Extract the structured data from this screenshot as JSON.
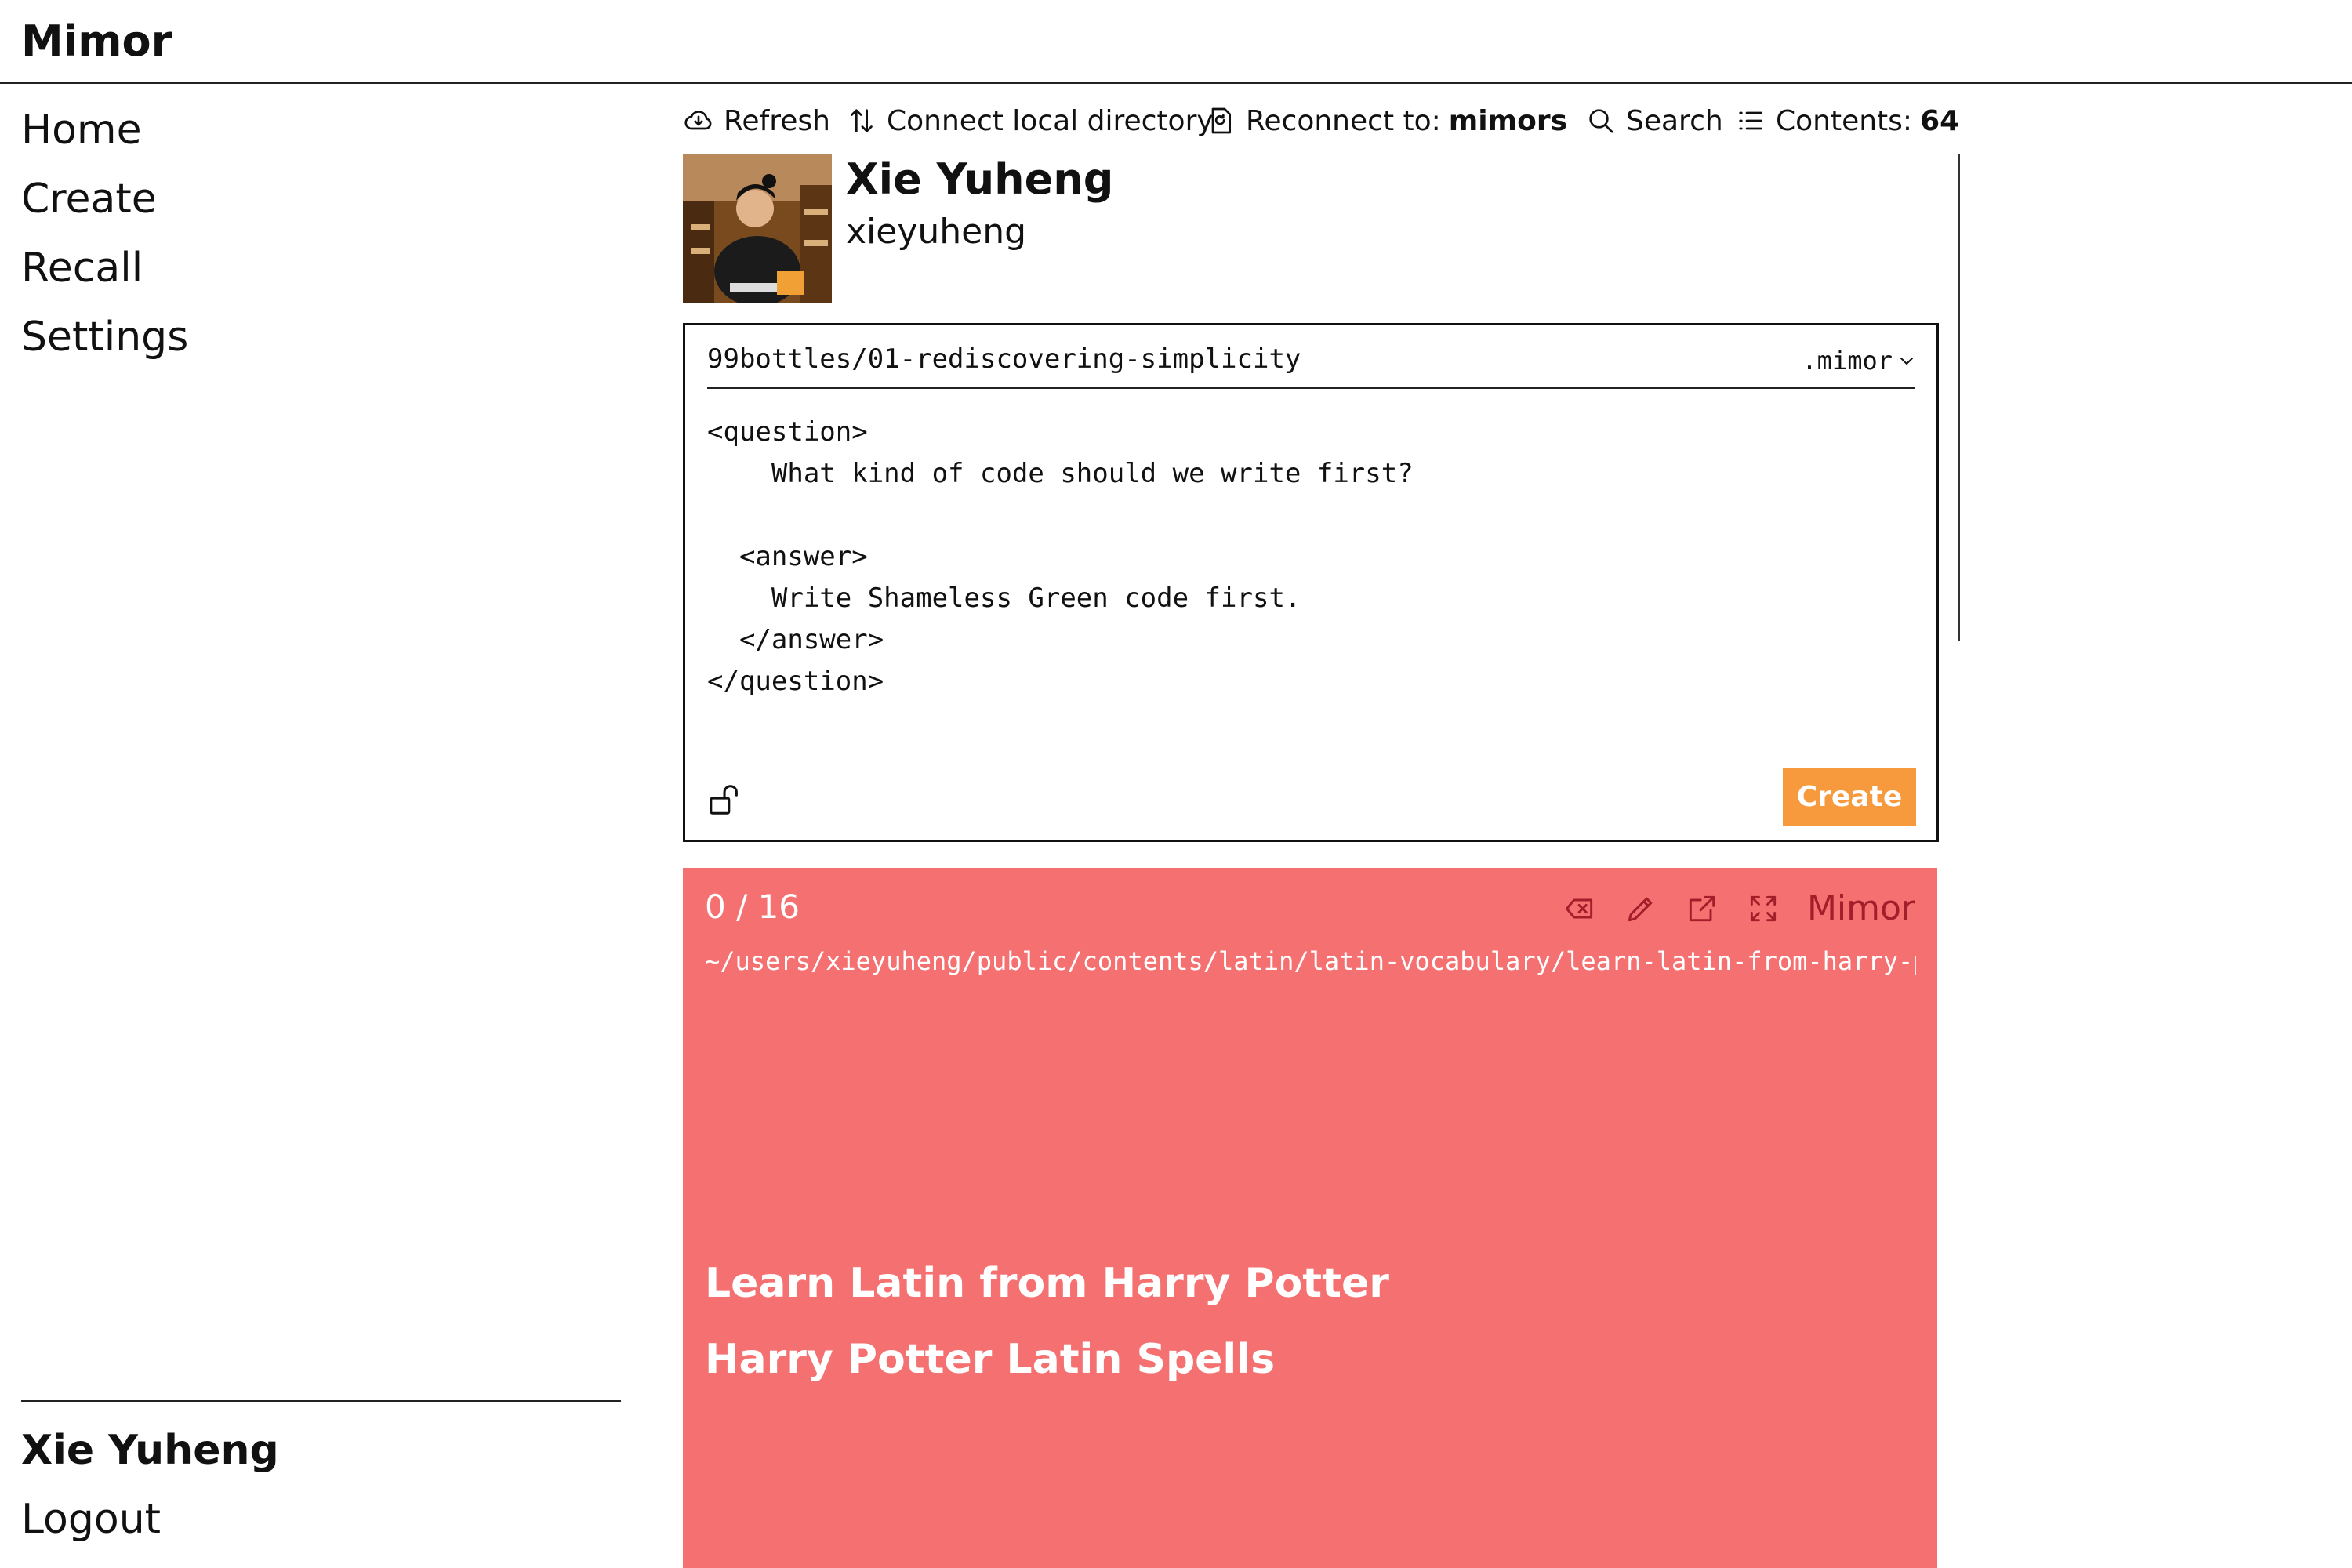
{
  "app": {
    "title": "Mimor"
  },
  "sidebar": {
    "items": [
      {
        "label": "Home"
      },
      {
        "label": "Create"
      },
      {
        "label": "Recall"
      },
      {
        "label": "Settings"
      }
    ],
    "user_name": "Xie Yuheng",
    "logout_label": "Logout"
  },
  "toolbar": {
    "refresh_label": "Refresh",
    "connect_label": "Connect local directory",
    "reconnect_label": "Reconnect to:",
    "reconnect_target": "mimors",
    "search_label": "Search",
    "contents_label": "Contents:",
    "contents_count": "64"
  },
  "profile": {
    "name": "Xie Yuheng",
    "handle": "xieyuheng"
  },
  "editor": {
    "path": "99bottles/01-rediscovering-simplicity",
    "extension": ".mimor",
    "content": "<question>\n    What kind of code should we write first?\n\n  <answer>\n    Write Shameless Green code first.\n  </answer>\n</question>",
    "create_label": "Create"
  },
  "card": {
    "progress": "0 / 16",
    "brand": "Mimor",
    "path": "~/users/xieyuheng/public/contents/latin/latin-vocabulary/learn-latin-from-harry-potter",
    "lines": [
      "Learn Latin from Harry Potter",
      "Harry Potter Latin Spells"
    ],
    "background": "#f57171",
    "brand_color": "#a11f2b"
  },
  "colors": {
    "accent": "#f79a3e"
  },
  "icons": [
    "cloud-download-icon",
    "arrows-up-down-icon",
    "document-reconnect-icon",
    "search-icon",
    "list-icon",
    "unlock-icon",
    "backspace-icon",
    "pencil-icon",
    "external-link-icon",
    "expand-icon",
    "chevron-down-icon"
  ]
}
